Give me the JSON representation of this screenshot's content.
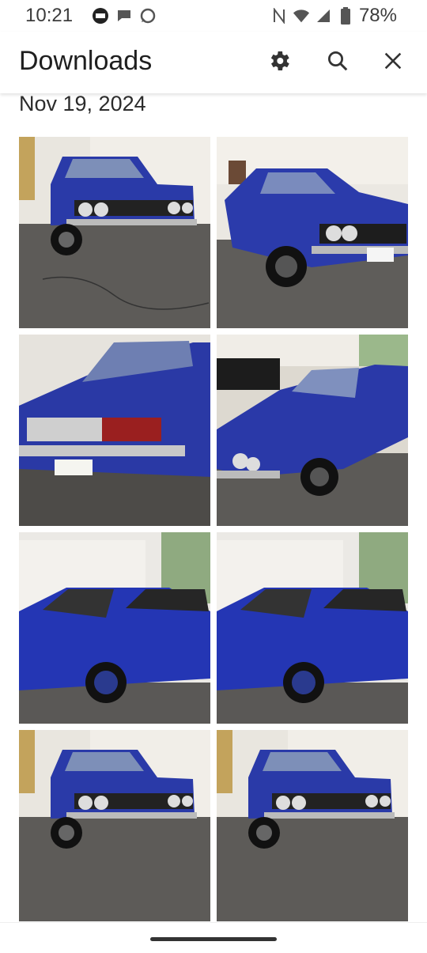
{
  "status_bar": {
    "time": "10:21",
    "battery_percent": "78%",
    "icons": [
      "tv-app-icon",
      "messages-icon",
      "whatsapp-icon",
      "nfc-icon",
      "wifi-icon",
      "signal-icon",
      "battery-icon"
    ]
  },
  "app_bar": {
    "title": "Downloads",
    "actions": [
      "settings-icon",
      "search-icon",
      "close-icon"
    ]
  },
  "section": {
    "date": "Nov 19, 2024"
  },
  "photos": [
    {
      "name": "photo-front-view-1",
      "content": "blue classic coupe front view in driveway"
    },
    {
      "name": "photo-front-3q-1",
      "content": "blue classic coupe front three-quarter view"
    },
    {
      "name": "photo-rear-view",
      "content": "blue classic coupe rear view with tail lights"
    },
    {
      "name": "photo-front-3q-2",
      "content": "blue classic coupe front three-quarter side view"
    },
    {
      "name": "photo-side-view-1",
      "content": "blue classic coupe side view near garage"
    },
    {
      "name": "photo-side-view-2",
      "content": "blue classic coupe side view near garage"
    },
    {
      "name": "photo-front-view-2",
      "content": "blue classic coupe front view in driveway"
    },
    {
      "name": "photo-front-view-3",
      "content": "blue classic coupe front view in driveway"
    }
  ],
  "colors": {
    "car_blue": "#2a3aa8",
    "garage_white": "#e8e6e1",
    "asphalt": "#5d5b58"
  }
}
